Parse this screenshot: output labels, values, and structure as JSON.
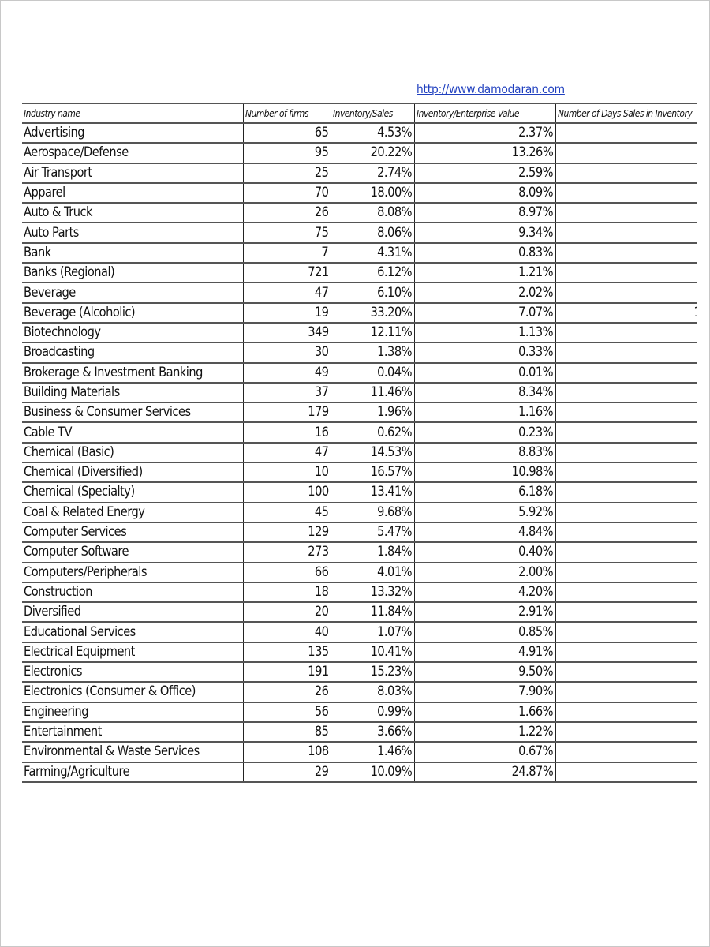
{
  "source_link": "http://www.damodaran.com",
  "table": {
    "headers": [
      "Industry name",
      "Number of firms",
      "Inventory/Sales",
      "Inventory/Enterprise Value",
      "Number of Days Sales in Inventory"
    ],
    "rows": [
      {
        "industry": "Advertising",
        "firms": "65",
        "inv_sales": "4.53%",
        "inv_ev": "2.37%",
        "days": ""
      },
      {
        "industry": "Aerospace/Defense",
        "firms": "95",
        "inv_sales": "20.22%",
        "inv_ev": "13.26%",
        "days": ""
      },
      {
        "industry": "Air Transport",
        "firms": "25",
        "inv_sales": "2.74%",
        "inv_ev": "2.59%",
        "days": ""
      },
      {
        "industry": "Apparel",
        "firms": "70",
        "inv_sales": "18.00%",
        "inv_ev": "8.09%",
        "days": ""
      },
      {
        "industry": "Auto & Truck",
        "firms": "26",
        "inv_sales": "8.08%",
        "inv_ev": "8.97%",
        "days": ""
      },
      {
        "industry": "Auto Parts",
        "firms": "75",
        "inv_sales": "8.06%",
        "inv_ev": "9.34%",
        "days": ""
      },
      {
        "industry": "Bank",
        "firms": "7",
        "inv_sales": "4.31%",
        "inv_ev": "0.83%",
        "days": ""
      },
      {
        "industry": "Banks (Regional)",
        "firms": "721",
        "inv_sales": "6.12%",
        "inv_ev": "1.21%",
        "days": ""
      },
      {
        "industry": "Beverage",
        "firms": "47",
        "inv_sales": "6.10%",
        "inv_ev": "2.02%",
        "days": ""
      },
      {
        "industry": "Beverage (Alcoholic)",
        "firms": "19",
        "inv_sales": "33.20%",
        "inv_ev": "7.07%",
        "days": "1"
      },
      {
        "industry": "Biotechnology",
        "firms": "349",
        "inv_sales": "12.11%",
        "inv_ev": "1.13%",
        "days": ""
      },
      {
        "industry": "Broadcasting",
        "firms": "30",
        "inv_sales": "1.38%",
        "inv_ev": "0.33%",
        "days": ""
      },
      {
        "industry": "Brokerage & Investment Banking",
        "firms": "49",
        "inv_sales": "0.04%",
        "inv_ev": "0.01%",
        "days": ""
      },
      {
        "industry": "Building Materials",
        "firms": "37",
        "inv_sales": "11.46%",
        "inv_ev": "8.34%",
        "days": ""
      },
      {
        "industry": "Business & Consumer Services",
        "firms": "179",
        "inv_sales": "1.96%",
        "inv_ev": "1.16%",
        "days": ""
      },
      {
        "industry": "Cable TV",
        "firms": "16",
        "inv_sales": "0.62%",
        "inv_ev": "0.23%",
        "days": ""
      },
      {
        "industry": "Chemical (Basic)",
        "firms": "47",
        "inv_sales": "14.53%",
        "inv_ev": "8.83%",
        "days": ""
      },
      {
        "industry": "Chemical (Diversified)",
        "firms": "10",
        "inv_sales": "16.57%",
        "inv_ev": "10.98%",
        "days": ""
      },
      {
        "industry": "Chemical (Specialty)",
        "firms": "100",
        "inv_sales": "13.41%",
        "inv_ev": "6.18%",
        "days": ""
      },
      {
        "industry": "Coal & Related Energy",
        "firms": "45",
        "inv_sales": "9.68%",
        "inv_ev": "5.92%",
        "days": ""
      },
      {
        "industry": "Computer Services",
        "firms": "129",
        "inv_sales": "5.47%",
        "inv_ev": "4.84%",
        "days": ""
      },
      {
        "industry": "Computer Software",
        "firms": "273",
        "inv_sales": "1.84%",
        "inv_ev": "0.40%",
        "days": ""
      },
      {
        "industry": "Computers/Peripherals",
        "firms": "66",
        "inv_sales": "4.01%",
        "inv_ev": "2.00%",
        "days": ""
      },
      {
        "industry": "Construction",
        "firms": "18",
        "inv_sales": "13.32%",
        "inv_ev": "4.20%",
        "days": ""
      },
      {
        "industry": "Diversified",
        "firms": "20",
        "inv_sales": "11.84%",
        "inv_ev": "2.91%",
        "days": ""
      },
      {
        "industry": "Educational Services",
        "firms": "40",
        "inv_sales": "1.07%",
        "inv_ev": "0.85%",
        "days": ""
      },
      {
        "industry": "Electrical Equipment",
        "firms": "135",
        "inv_sales": "10.41%",
        "inv_ev": "4.91%",
        "days": ""
      },
      {
        "industry": "Electronics",
        "firms": "191",
        "inv_sales": "15.23%",
        "inv_ev": "9.50%",
        "days": ""
      },
      {
        "industry": "Electronics (Consumer & Office)",
        "firms": "26",
        "inv_sales": "8.03%",
        "inv_ev": "7.90%",
        "days": ""
      },
      {
        "industry": "Engineering",
        "firms": "56",
        "inv_sales": "0.99%",
        "inv_ev": "1.66%",
        "days": ""
      },
      {
        "industry": "Entertainment",
        "firms": "85",
        "inv_sales": "3.66%",
        "inv_ev": "1.22%",
        "days": ""
      },
      {
        "industry": "Environmental & Waste Services",
        "firms": "108",
        "inv_sales": "1.46%",
        "inv_ev": "0.67%",
        "days": ""
      },
      {
        "industry": "Farming/Agriculture",
        "firms": "29",
        "inv_sales": "10.09%",
        "inv_ev": "24.87%",
        "days": ""
      }
    ]
  }
}
